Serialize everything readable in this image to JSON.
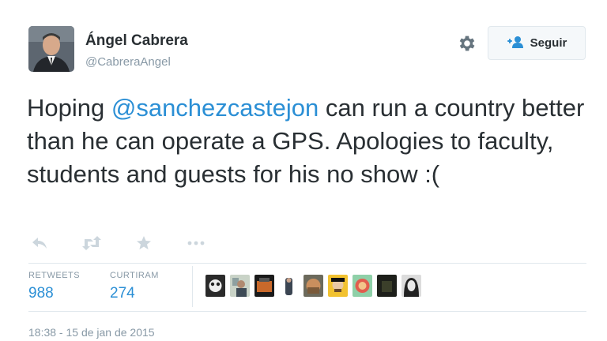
{
  "author": {
    "name": "Ángel Cabrera",
    "handle": "@CabreraAngel"
  },
  "header": {
    "follow_label": "Seguir",
    "gear_icon": "gear-icon",
    "follow_icon": "add-user-icon"
  },
  "tweet": {
    "text_before_mention": "Hoping ",
    "mention": "@sanchezcastejon",
    "text_after_mention": " can run a country better than he can operate a GPS. Apologies to faculty, students and guests for his no show :("
  },
  "actions": [
    "reply-icon",
    "retweet-icon",
    "favorite-icon",
    "more-icon"
  ],
  "stats": {
    "retweets_label": "RETWEETS",
    "retweets_value": "988",
    "favorites_label": "CURTIRAM",
    "favorites_value": "274"
  },
  "favoriters_count": 9,
  "timestamp": "18:38 - 15 de jan de 2015",
  "colors": {
    "link": "#2b8fd5",
    "text": "#292f33",
    "muted": "#8899a6",
    "border": "#e1e8ed"
  }
}
